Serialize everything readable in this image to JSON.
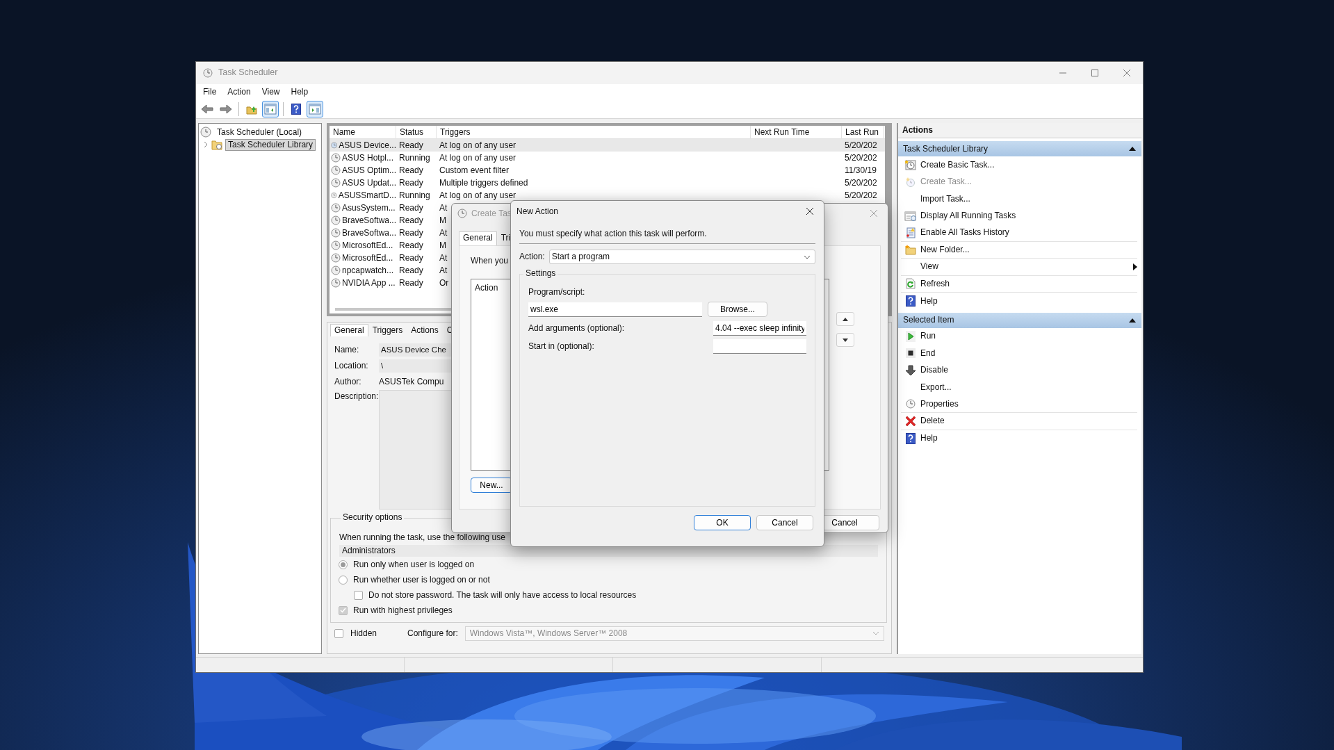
{
  "window": {
    "title": "Task Scheduler"
  },
  "menu": [
    {
      "label": "File"
    },
    {
      "label": "Action"
    },
    {
      "label": "View"
    },
    {
      "label": "Help"
    }
  ],
  "toolbar": [
    {
      "kind": "back",
      "on": false
    },
    {
      "kind": "forward",
      "on": false
    },
    {
      "kind": "up-folder",
      "on": false
    },
    {
      "kind": "tree-pane",
      "on": true
    },
    {
      "kind": "help",
      "on": false
    },
    {
      "kind": "action-pane",
      "on": true
    }
  ],
  "tree": [
    {
      "label": "Task Scheduler (Local)",
      "selected": false,
      "children": [
        {
          "label": "Task Scheduler Library",
          "selected": true
        }
      ]
    }
  ],
  "task_list": {
    "columns": [
      "Name",
      "Status",
      "Triggers",
      "Next Run Time",
      "Last Run"
    ],
    "rows": [
      {
        "name": "ASUS Device...",
        "status": "Ready",
        "triggers": "At log on of any user",
        "last_run": "5/20/202",
        "selected": true
      },
      {
        "name": "ASUS Hotpl...",
        "status": "Running",
        "triggers": "At log on of any user",
        "last_run": "5/20/202",
        "selected": false
      },
      {
        "name": "ASUS Optim...",
        "status": "Ready",
        "triggers": "Custom event filter",
        "last_run": "11/30/19",
        "selected": false
      },
      {
        "name": "ASUS Updat...",
        "status": "Ready",
        "triggers": "Multiple triggers defined",
        "last_run": "5/20/202",
        "selected": false
      },
      {
        "name": "ASUSSmartD...",
        "status": "Running",
        "triggers": "At log on of any user",
        "last_run": "5/20/202",
        "selected": false
      },
      {
        "name": "AsusSystem...",
        "status": "Ready",
        "triggers": "At",
        "selected": false
      },
      {
        "name": "BraveSoftwa...",
        "status": "Ready",
        "triggers": "M",
        "selected": false
      },
      {
        "name": "BraveSoftwa...",
        "status": "Ready",
        "triggers": "At",
        "selected": false
      },
      {
        "name": "MicrosoftEd...",
        "status": "Ready",
        "triggers": "M",
        "selected": false
      },
      {
        "name": "MicrosoftEd...",
        "status": "Ready",
        "triggers": "At",
        "selected": false
      },
      {
        "name": "npcapwatch...",
        "status": "Ready",
        "triggers": "At",
        "selected": false
      },
      {
        "name": "NVIDIA App ...",
        "status": "Ready",
        "triggers": "Or",
        "selected": false
      }
    ]
  },
  "details": {
    "tabs": [
      {
        "label": "General",
        "selected": true
      },
      {
        "label": "Triggers",
        "selected": false
      },
      {
        "label": "Actions",
        "selected": false
      },
      {
        "label": "C",
        "selected": false
      }
    ],
    "fields": [
      {
        "kind": "box",
        "label": "Name:",
        "value": "ASUS Device Che"
      },
      {
        "kind": "box",
        "label": "Location:",
        "value": "\\"
      },
      {
        "kind": "plain",
        "label": "Author:",
        "value": "ASUSTek Compu"
      },
      {
        "kind": "area",
        "label": "Description:"
      }
    ],
    "security": {
      "title": "Security options",
      "note": "When running the task, use the following use",
      "account": "Administrators",
      "options": [
        {
          "kind": "radio",
          "label": "Run only when user is logged on",
          "selected": true
        },
        {
          "kind": "radio",
          "label": "Run whether user is logged on or not",
          "selected": false,
          "children": [
            {
              "kind": "checkbox",
              "label": "Do not store password.  The task will only have access to local resources",
              "checked": false
            }
          ]
        },
        {
          "kind": "checkbox",
          "label": "Run with highest privileges",
          "checked": true
        }
      ]
    },
    "hidden": {
      "label": "Hidden",
      "checked": false
    },
    "configure": {
      "label": "Configure for:",
      "value": "Windows Vista™, Windows Server™ 2008"
    }
  },
  "create_task_dialog": {
    "title": "Create Tas",
    "tabs": [
      {
        "label": "General",
        "selected": true
      },
      {
        "label": "Tri",
        "selected": false
      }
    ],
    "prompt": "When you",
    "list_header": "Action",
    "new_button": "New...",
    "cancel_button": "Cancel"
  },
  "new_action_dialog": {
    "title": "New Action",
    "instruction": "You must specify what action this task will perform.",
    "action_label": "Action:",
    "action_value": "Start a program",
    "settings_title": "Settings",
    "program_label": "Program/script:",
    "program_value": "wsl.exe",
    "browse_button": "Browse...",
    "arguments_label": "Add arguments (optional):",
    "arguments_value": "4.04 --exec sleep infinity",
    "start_in_label": "Start in (optional):",
    "ok_button": "OK",
    "cancel_button": "Cancel"
  },
  "actions_pane": {
    "title": "Actions",
    "sections": [
      {
        "title": "Task Scheduler Library",
        "expanded": true,
        "items": [
          {
            "label": "Create Basic Task...",
            "disabled": false,
            "submenu": false,
            "divider_after": false
          },
          {
            "label": "Create Task...",
            "disabled": true,
            "submenu": false,
            "divider_after": false
          },
          {
            "label": "Import Task...",
            "disabled": false,
            "submenu": false,
            "divider_after": false
          },
          {
            "label": "Display All Running Tasks",
            "disabled": false,
            "submenu": false,
            "divider_after": false
          },
          {
            "label": "Enable All Tasks History",
            "disabled": false,
            "submenu": false,
            "divider_after": true
          },
          {
            "label": "New Folder...",
            "disabled": false,
            "submenu": false,
            "divider_after": true
          },
          {
            "label": "View",
            "disabled": false,
            "submenu": true,
            "divider_after": true
          },
          {
            "label": "Refresh",
            "disabled": false,
            "submenu": false,
            "divider_after": true
          },
          {
            "label": "Help",
            "disabled": false,
            "submenu": false,
            "divider_after": false
          }
        ]
      },
      {
        "title": "Selected Item",
        "expanded": true,
        "items": [
          {
            "label": "Run",
            "disabled": false,
            "submenu": false,
            "divider_after": false
          },
          {
            "label": "End",
            "disabled": false,
            "submenu": false,
            "divider_after": false
          },
          {
            "label": "Disable",
            "disabled": false,
            "submenu": false,
            "divider_after": false
          },
          {
            "label": "Export...",
            "disabled": false,
            "submenu": false,
            "divider_after": false
          },
          {
            "label": "Properties",
            "disabled": false,
            "submenu": false,
            "divider_after": true
          },
          {
            "label": "Delete",
            "disabled": false,
            "submenu": false,
            "divider_after": true
          },
          {
            "label": "Help",
            "disabled": false,
            "submenu": false,
            "divider_after": false
          }
        ]
      }
    ]
  }
}
